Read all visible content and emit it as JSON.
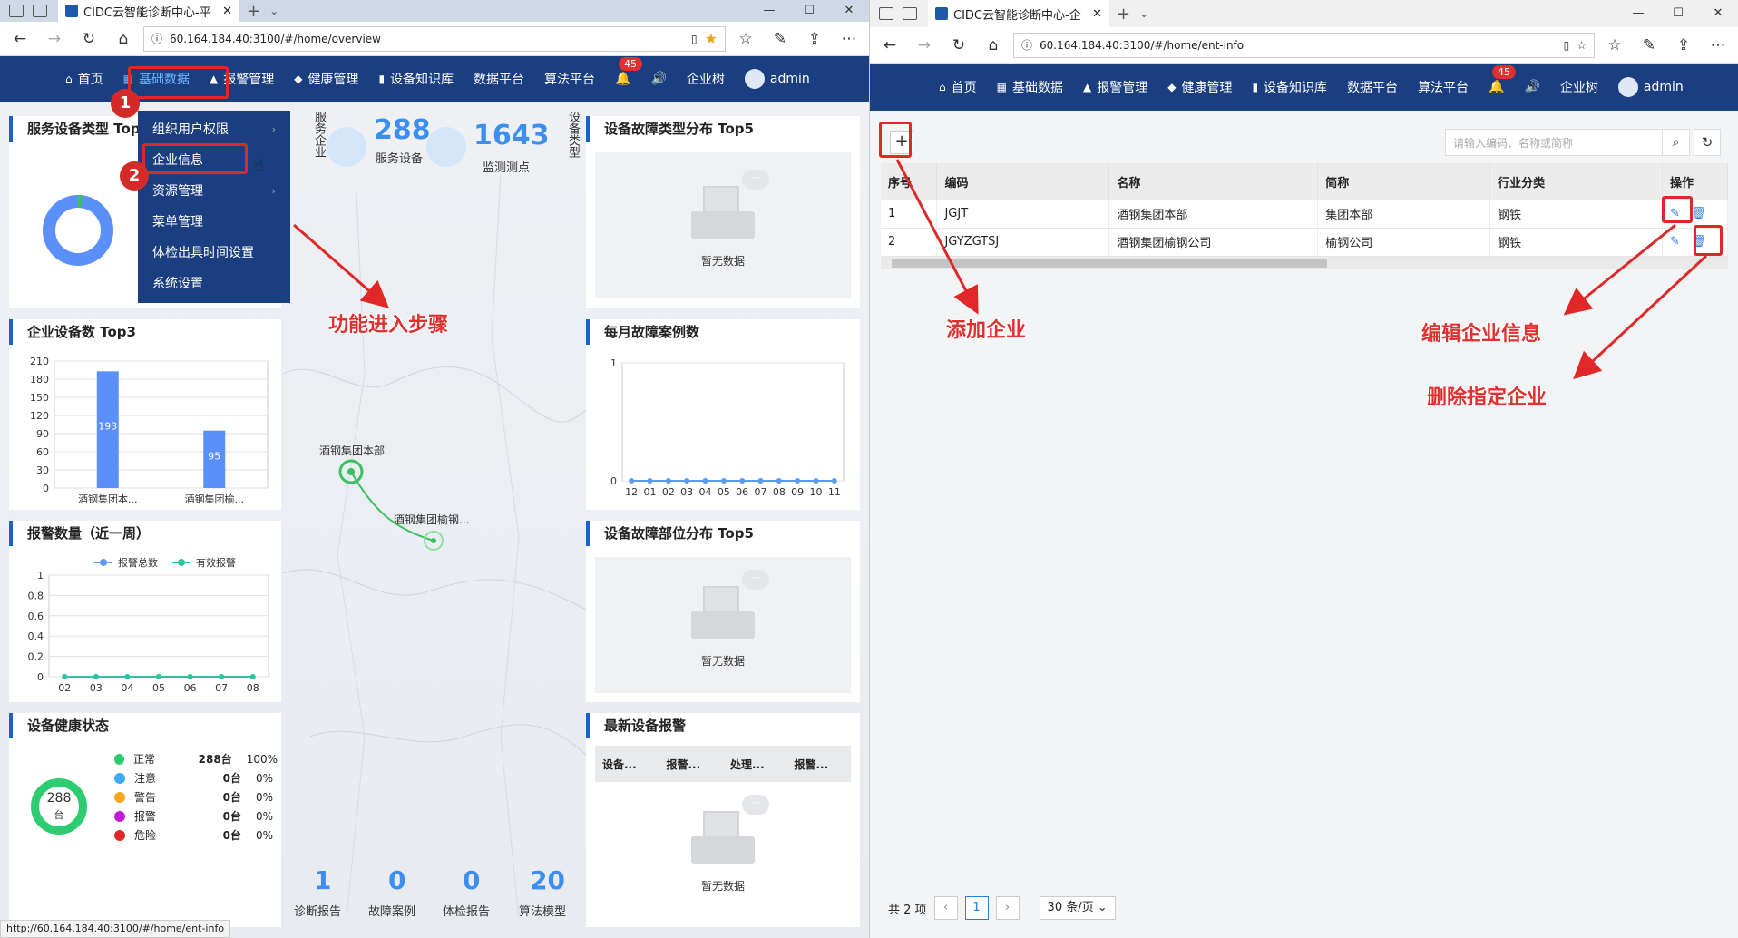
{
  "left": {
    "tab_title": "CIDC云智能诊断中心-平",
    "url": "60.164.184.40:3100/#/home/overview",
    "nav": [
      "首页",
      "基础数据",
      "报警管理",
      "健康管理",
      "设备知识库",
      "数据平台",
      "算法平台"
    ],
    "notif_count": "45",
    "nav_right": [
      "企业树",
      "admin"
    ],
    "menu": [
      "组织用户权限",
      "企业信息",
      "资源管理",
      "菜单管理",
      "体检出具时间设置",
      "系统设置"
    ],
    "steps": [
      "1",
      "2"
    ],
    "annotation": "功能进入步骤",
    "panel_titles": [
      "服务设备类型 Top5",
      "企业设备数 Top3",
      "报警数量（近一周）",
      "设备健康状态",
      "设备故障类型分布 Top5",
      "每月故障案例数",
      "设备故障部位分布 Top5",
      "最新设备报警"
    ],
    "stats": [
      {
        "value": "288",
        "label": "服务设备"
      },
      {
        "value": "1643",
        "label": "监测测点"
      }
    ],
    "stat_side_labels": [
      "服务企业",
      "设备类型"
    ],
    "map_points": [
      "酒钢集团本部",
      "酒钢集团榆钢..."
    ],
    "bottom_stats": [
      {
        "value": "1",
        "label": "诊断报告"
      },
      {
        "value": "0",
        "label": "故障案例"
      },
      {
        "value": "0",
        "label": "体检报告"
      },
      {
        "value": "20",
        "label": "算法模型"
      }
    ],
    "empty_text": "暂无数据",
    "alarm_headers": [
      "设备...",
      "报警...",
      "处理...",
      "报警..."
    ],
    "health": {
      "center_value": "288",
      "center_unit": "台",
      "rows": [
        {
          "label": "正常",
          "count": "288台",
          "pct": "100%",
          "color": "#2ecc71"
        },
        {
          "label": "注意",
          "count": "0台",
          "pct": "0%",
          "color": "#3fa9f5"
        },
        {
          "label": "警告",
          "count": "0台",
          "pct": "0%",
          "color": "#f5a623"
        },
        {
          "label": "报警",
          "count": "0台",
          "pct": "0%",
          "color": "#c71ad6"
        },
        {
          "label": "危险",
          "count": "0台",
          "pct": "0%",
          "color": "#e02828"
        }
      ]
    },
    "status_url": "http://60.164.184.40:3100/#/home/ent-info"
  },
  "chart_data": [
    {
      "type": "bar",
      "title": "企业设备数 Top3",
      "categories": [
        "酒钢集团本...",
        "酒钢集团榆..."
      ],
      "values": [
        193,
        95
      ],
      "yticks": [
        210,
        180,
        150,
        120,
        90,
        60,
        30,
        0
      ],
      "ylim": [
        0,
        210
      ],
      "color": "#5b8ff9"
    },
    {
      "type": "line",
      "title": "报警数量（近一周）",
      "x": [
        "02",
        "03",
        "04",
        "05",
        "06",
        "07",
        "08"
      ],
      "series": [
        {
          "name": "报警总数",
          "values": [
            0,
            0,
            0,
            0,
            0,
            0,
            0
          ],
          "color": "#5b9bf0"
        },
        {
          "name": "有效报警",
          "values": [
            0,
            0,
            0,
            0,
            0,
            0,
            0
          ],
          "color": "#2ec4a0"
        }
      ],
      "yticks": [
        "1",
        "0.8",
        "0.6",
        "0.4",
        "0.2",
        "0"
      ],
      "ylim": [
        0,
        1
      ]
    },
    {
      "type": "line",
      "title": "每月故障案例数",
      "x": [
        "12",
        "01",
        "02",
        "03",
        "04",
        "05",
        "06",
        "07",
        "08",
        "09",
        "10",
        "11"
      ],
      "series": [
        {
          "name": "",
          "values": [
            0,
            0,
            0,
            0,
            0,
            0,
            0,
            0,
            0,
            0,
            0,
            0
          ],
          "color": "#5b9bf0"
        }
      ],
      "yticks": [
        "1",
        "0"
      ],
      "ylim": [
        0,
        1
      ]
    }
  ],
  "right": {
    "tab_title": "CIDC云智能诊断中心-企",
    "url": "60.164.184.40:3100/#/home/ent-info",
    "nav": [
      "首页",
      "基础数据",
      "报警管理",
      "健康管理",
      "设备知识库",
      "数据平台",
      "算法平台"
    ],
    "notif_count": "45",
    "nav_right": [
      "企业树",
      "admin"
    ],
    "search_placeholder": "请输入编码、名称或简称",
    "headers": [
      "序号",
      "编码",
      "名称",
      "简称",
      "行业分类",
      "操作"
    ],
    "rows": [
      {
        "no": "1",
        "code": "JGJT",
        "name": "酒钢集团本部",
        "short": "集团本部",
        "industry": "钢铁"
      },
      {
        "no": "2",
        "code": "JGYZGTSJ",
        "name": "酒钢集团榆钢公司",
        "short": "榆钢公司",
        "industry": "钢铁"
      }
    ],
    "annotations": [
      "添加企业",
      "编辑企业信息",
      "删除指定企业"
    ],
    "pager": {
      "total": "共 2 项",
      "page": "1",
      "size": "30 条/页"
    }
  },
  "colors": {
    "nav_bg": "#1a3e80",
    "accent": "#3c8ff0",
    "annotation": "#e02828"
  }
}
